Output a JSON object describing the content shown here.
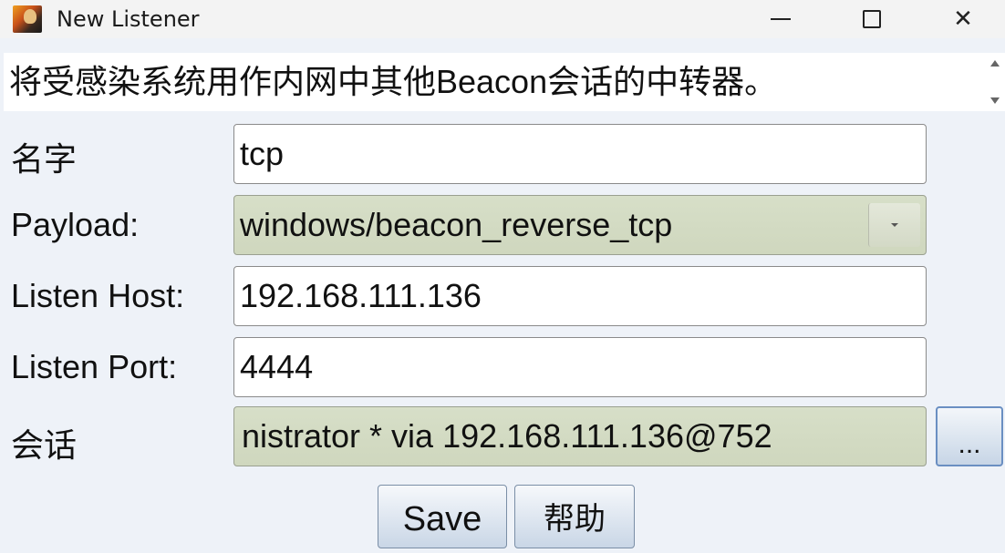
{
  "window": {
    "title": "New Listener",
    "minimize_glyph": "—",
    "close_glyph": "✕"
  },
  "description": "将受感染系统用作内网中其他Beacon会话的中转器。",
  "form": {
    "name": {
      "label": "名字",
      "value": "tcp"
    },
    "payload": {
      "label": "Payload:",
      "value": "windows/beacon_reverse_tcp"
    },
    "listen_host": {
      "label": "Listen Host:",
      "value": "192.168.111.136"
    },
    "listen_port": {
      "label": "Listen Port:",
      "value": "4444"
    },
    "session": {
      "label": "会话",
      "value": "nistrator * via  192.168.111.136@752",
      "browse_label": "..."
    }
  },
  "buttons": {
    "save": "Save",
    "help": "帮助"
  },
  "icons": {
    "app": "app-logo-icon",
    "minimize": "minimize-icon",
    "maximize": "maximize-icon",
    "close": "close-icon",
    "dropdown": "chevron-down-icon"
  }
}
